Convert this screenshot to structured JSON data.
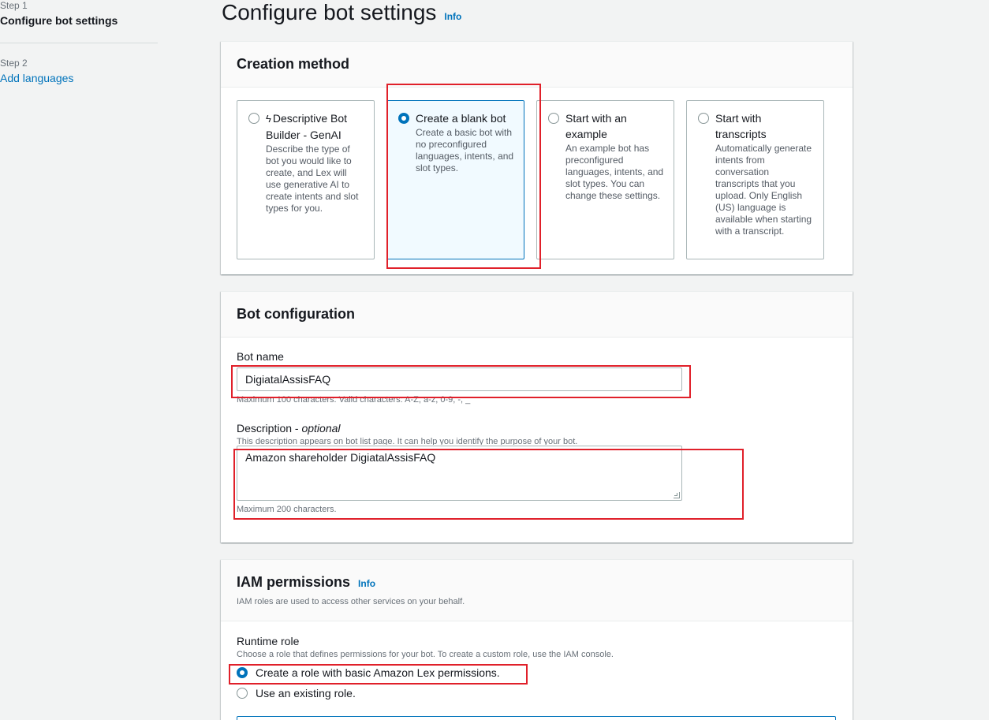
{
  "nav": {
    "step1_label": "Step 1",
    "step1_title": "Configure bot settings",
    "step2_label": "Step 2",
    "step2_title": "Add languages"
  },
  "page": {
    "title": "Configure bot settings",
    "info": "Info"
  },
  "creation": {
    "header": "Creation method",
    "tiles": [
      {
        "title": "Descriptive Bot Builder - GenAI",
        "desc": "Describe the type of bot you would like to create, and Lex will use generative AI to create intents and slot types for you.",
        "icon": "lightning-bolt-icon",
        "selected": false
      },
      {
        "title": "Create a blank bot",
        "desc": "Create a basic bot with no preconfigured languages, intents, and slot types.",
        "selected": true
      },
      {
        "title": "Start with an example",
        "desc": "An example bot has preconfigured languages, intents, and slot types. You can change these settings.",
        "selected": false
      },
      {
        "title": "Start with transcripts",
        "desc": "Automatically generate intents from conversation transcripts that you upload. Only English (US) language is available when starting with a transcript.",
        "selected": false
      }
    ]
  },
  "bot_config": {
    "header": "Bot configuration",
    "name_label": "Bot name",
    "name_value": "DigiatalAssisFAQ",
    "name_hint": "Maximum 100 characters. Valid characters: A-Z, a-z, 0-9, -, _",
    "desc_label": "Description - ",
    "desc_optional": "optional",
    "desc_hint_top": "This description appears on bot list page. It can help you identify the purpose of your bot.",
    "desc_value": "Amazon shareholder DigiatalAssisFAQ",
    "desc_hint_bottom": "Maximum 200 characters."
  },
  "iam": {
    "header": "IAM permissions",
    "info": "Info",
    "subtitle": "IAM roles are used to access other services on your behalf.",
    "runtime_label": "Runtime role",
    "runtime_hint": "Choose a role that defines permissions for your bot. To create a custom role, use the IAM console.",
    "option_create": "Create a role with basic Amazon Lex permissions.",
    "option_existing": "Use an existing role."
  }
}
